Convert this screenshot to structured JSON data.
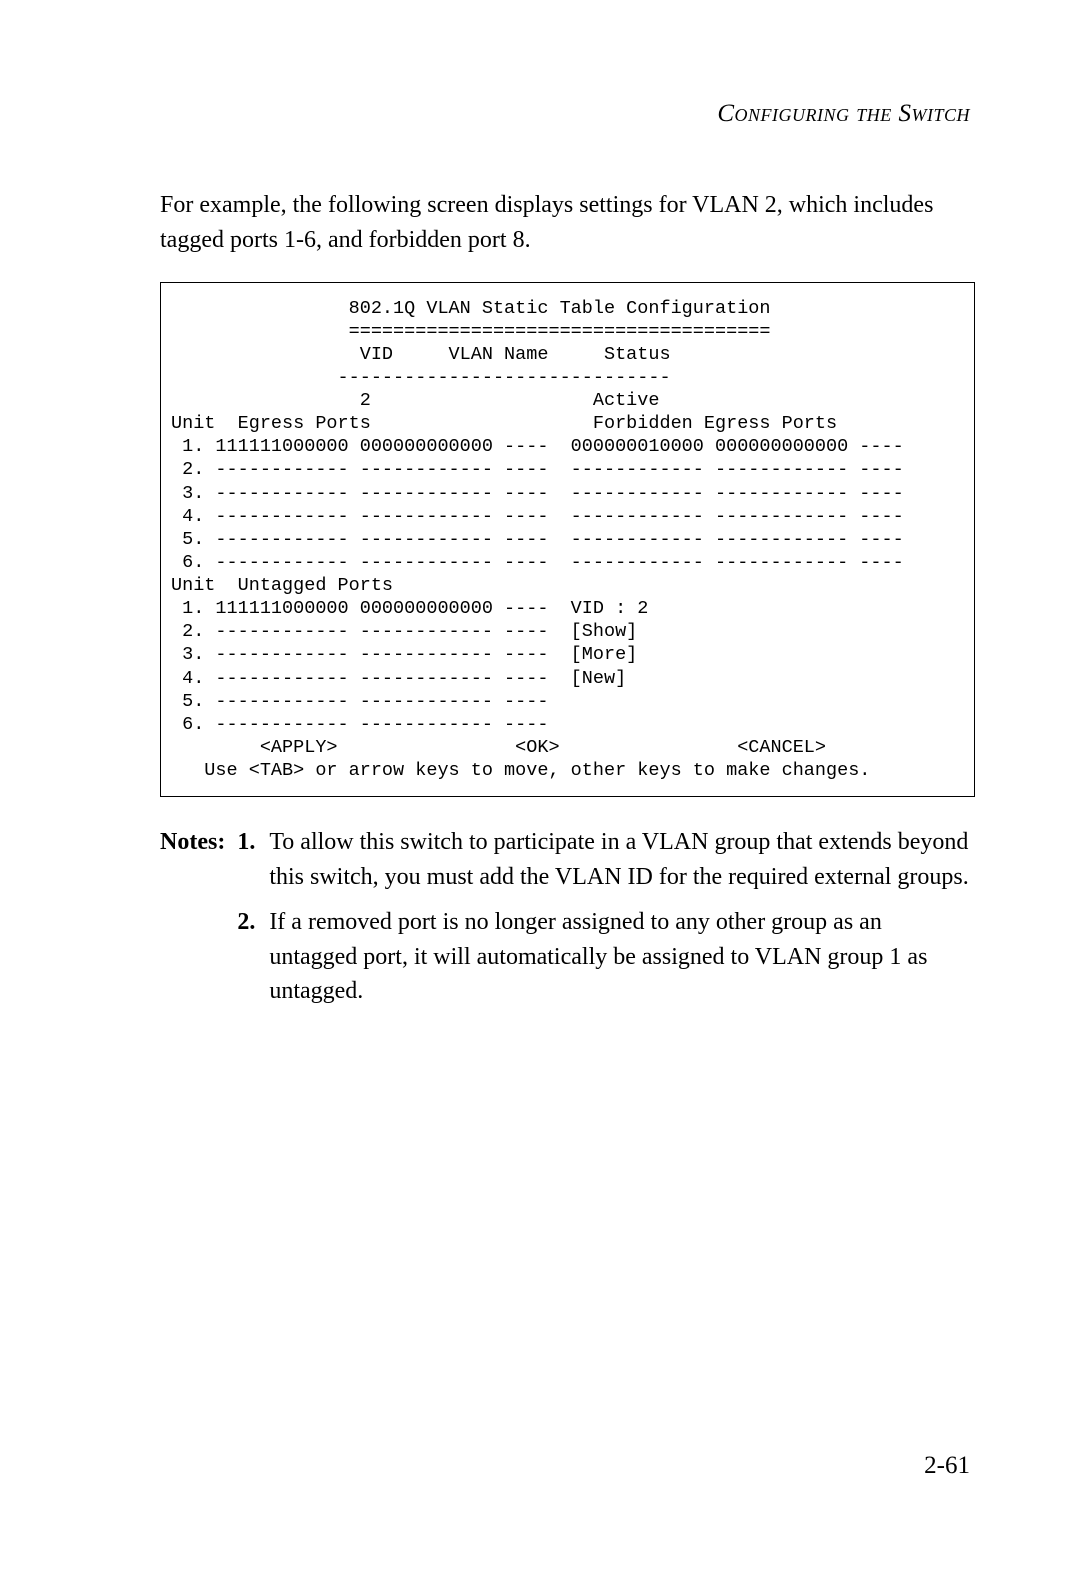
{
  "header": "Configuring the Switch",
  "intro": "For example, the following screen displays settings for VLAN 2, which includes tagged ports 1-6, and forbidden port 8.",
  "terminal": {
    "title": "802.1Q VLAN Static Table Configuration",
    "title_underline": "======================================",
    "cols_header": "VID     VLAN Name     Status",
    "cols_underline": "------------------------------",
    "vid_value": "2",
    "status_value": "Active",
    "egress_header_left": "Unit  Egress Ports",
    "egress_header_right": "Forbidden Egress Ports",
    "egress_rows": [
      {
        "n": "1",
        "left": "111111000000 000000000000 ----",
        "right": "000000010000 000000000000 ----"
      },
      {
        "n": "2",
        "left": "------------ ------------ ----",
        "right": "------------ ------------ ----"
      },
      {
        "n": "3",
        "left": "------------ ------------ ----",
        "right": "------------ ------------ ----"
      },
      {
        "n": "4",
        "left": "------------ ------------ ----",
        "right": "------------ ------------ ----"
      },
      {
        "n": "5",
        "left": "------------ ------------ ----",
        "right": "------------ ------------ ----"
      },
      {
        "n": "6",
        "left": "------------ ------------ ----",
        "right": "------------ ------------ ----"
      }
    ],
    "untagged_header": "Unit  Untagged Ports",
    "untagged_rows": [
      {
        "n": "1",
        "left": "111111000000 000000000000 ----",
        "right": "VID : 2"
      },
      {
        "n": "2",
        "left": "------------ ------------ ----",
        "right": "[Show]"
      },
      {
        "n": "3",
        "left": "------------ ------------ ----",
        "right": "[More]"
      },
      {
        "n": "4",
        "left": "------------ ------------ ----",
        "right": "[New]"
      },
      {
        "n": "5",
        "left": "------------ ------------ ----",
        "right": ""
      },
      {
        "n": "6",
        "left": "------------ ------------ ----",
        "right": ""
      }
    ],
    "apply": "<APPLY>",
    "ok": "<OK>",
    "cancel": "<CANCEL>",
    "hint": "Use <TAB> or arrow keys to move, other keys to make changes."
  },
  "notes_label": "Notes:",
  "notes": [
    {
      "n": "1.",
      "text": "To allow this switch to participate in a VLAN group that extends beyond this switch, you must add the VLAN ID for the required external groups."
    },
    {
      "n": "2.",
      "text": "If a removed port is no longer assigned to any other group as an untagged port, it will automatically be assigned to VLAN group 1 as untagged."
    }
  ],
  "page_number": "2-61"
}
